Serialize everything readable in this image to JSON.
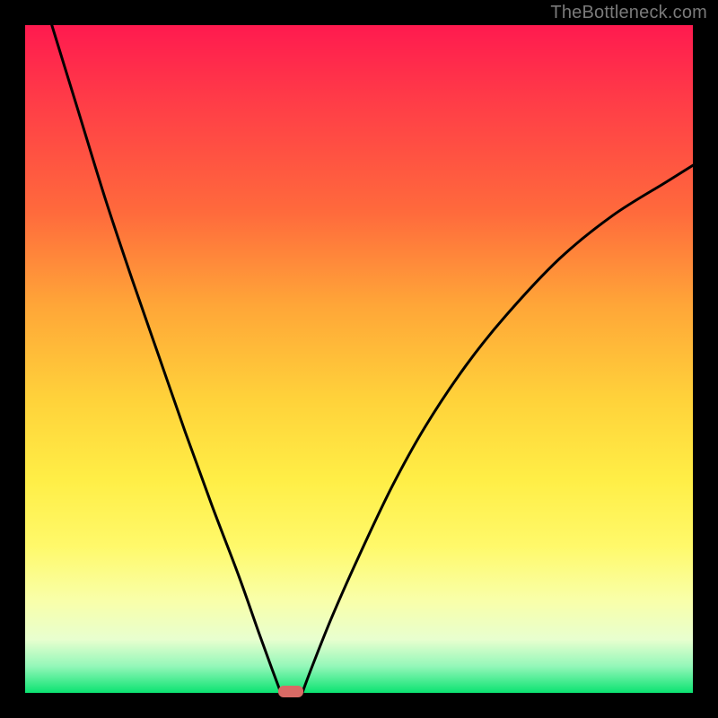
{
  "watermark": "TheBottleneck.com",
  "chart_data": {
    "type": "line",
    "title": "",
    "xlabel": "",
    "ylabel": "",
    "xlim": [
      0,
      1
    ],
    "ylim": [
      0,
      1
    ],
    "gradient_stops": [
      {
        "pos": 0.0,
        "color": "#ff1a4f"
      },
      {
        "pos": 0.12,
        "color": "#ff3e47"
      },
      {
        "pos": 0.28,
        "color": "#ff6a3c"
      },
      {
        "pos": 0.42,
        "color": "#ffa638"
      },
      {
        "pos": 0.56,
        "color": "#ffd23a"
      },
      {
        "pos": 0.68,
        "color": "#ffee46"
      },
      {
        "pos": 0.78,
        "color": "#fff96a"
      },
      {
        "pos": 0.86,
        "color": "#f9ffa8"
      },
      {
        "pos": 0.92,
        "color": "#e8ffcf"
      },
      {
        "pos": 0.96,
        "color": "#94f7b9"
      },
      {
        "pos": 1.0,
        "color": "#0be371"
      }
    ],
    "series": [
      {
        "name": "left-limb",
        "x": [
          0.04,
          0.08,
          0.12,
          0.16,
          0.2,
          0.24,
          0.28,
          0.32,
          0.35,
          0.37,
          0.383
        ],
        "y": [
          1.0,
          0.87,
          0.74,
          0.62,
          0.505,
          0.39,
          0.28,
          0.175,
          0.09,
          0.035,
          0.0
        ]
      },
      {
        "name": "right-limb",
        "x": [
          0.415,
          0.43,
          0.46,
          0.5,
          0.55,
          0.6,
          0.66,
          0.72,
          0.8,
          0.88,
          0.96,
          1.0
        ],
        "y": [
          0.0,
          0.04,
          0.115,
          0.205,
          0.31,
          0.4,
          0.49,
          0.565,
          0.65,
          0.715,
          0.765,
          0.79
        ]
      }
    ],
    "marker": {
      "x": 0.398,
      "y": 0.0,
      "color": "#d96a65"
    }
  }
}
